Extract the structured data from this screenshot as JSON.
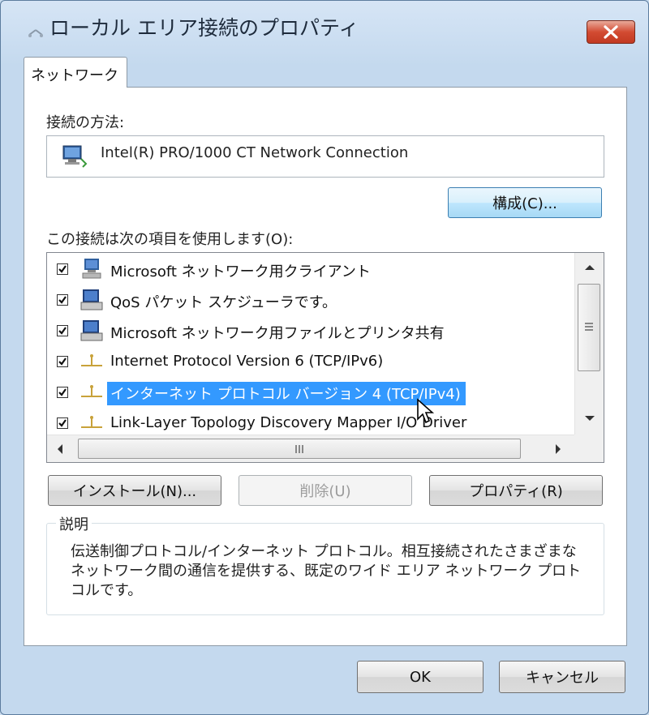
{
  "window": {
    "title": "ローカル エリア接続のプロパティ"
  },
  "tabs": [
    {
      "label": "ネットワーク",
      "selected": true
    }
  ],
  "connect_using": {
    "label": "接続の方法:",
    "adapter": "Intel(R) PRO/1000 CT Network Connection",
    "configure_button": "構成(C)..."
  },
  "items": {
    "label": "この接続は次の項目を使用します(O):",
    "list": [
      {
        "label": "Microsoft ネットワーク用クライアント",
        "checked": true,
        "icon": "network-client-icon"
      },
      {
        "label": "QoS パケット スケジューラです。",
        "checked": true,
        "icon": "qos-service-icon"
      },
      {
        "label": "Microsoft ネットワーク用ファイルとプリンタ共有",
        "checked": true,
        "icon": "file-printer-sharing-icon"
      },
      {
        "label": "Internet Protocol Version 6 (TCP/IPv6)",
        "checked": true,
        "icon": "protocol-icon"
      },
      {
        "label": "インターネット プロトコル バージョン 4 (TCP/IPv4)",
        "checked": true,
        "icon": "protocol-icon",
        "selected": true
      },
      {
        "label": "Link-Layer Topology Discovery Mapper I/O Driver",
        "checked": true,
        "icon": "protocol-icon"
      }
    ]
  },
  "buttons": {
    "install": "インストール(N)...",
    "uninstall": "削除(U)",
    "properties": "プロパティ(R)",
    "ok": "OK",
    "cancel": "キャンセル"
  },
  "description": {
    "legend": "説明",
    "text": "伝送制御プロトコル/インターネット プロトコル。相互接続されたさまざまなネットワーク間の通信を提供する、既定のワイド エリア ネットワーク プロトコルです。"
  },
  "colors": {
    "selection": "#3399ff",
    "close_button": "#c8412a"
  }
}
